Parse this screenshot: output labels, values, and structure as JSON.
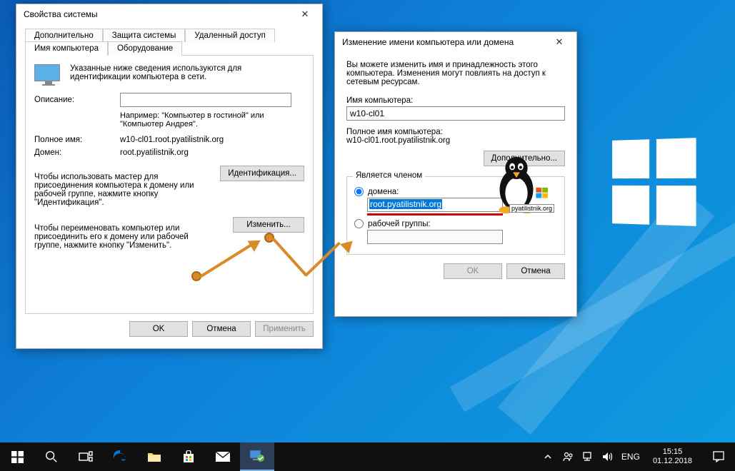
{
  "desktop": {
    "os": "Windows 10"
  },
  "dialog1": {
    "title": "Свойства системы",
    "tabs_row1": [
      "Дополнительно",
      "Защита системы",
      "Удаленный доступ"
    ],
    "tabs_row2": [
      "Имя компьютера",
      "Оборудование"
    ],
    "active_tab": "Имя компьютера",
    "intro": "Указанные ниже сведения используются для идентификации компьютера в сети.",
    "desc_label": "Описание:",
    "desc_value": "",
    "desc_hint": "Например: \"Компьютер в гостиной\" или \"Компьютер Андрея\".",
    "fullname_label": "Полное имя:",
    "fullname_value": "w10-cl01.root.pyatilistnik.org",
    "domain_label": "Домен:",
    "domain_value": "root.pyatilistnik.org",
    "wizard_text": "Чтобы использовать мастер для присоединения компьютера к домену или рабочей группе, нажмите кнопку \"Идентификация\".",
    "ident_btn": "Идентификация...",
    "rename_text": "Чтобы переименовать компьютер или присоединить его к домену или рабочей группе, нажмите кнопку \"Изменить\".",
    "change_btn": "Изменить...",
    "ok_btn": "OK",
    "cancel_btn": "Отмена",
    "apply_btn": "Применить"
  },
  "dialog2": {
    "title": "Изменение имени компьютера или домена",
    "intro": "Вы можете изменить имя и принадлежность этого компьютера. Изменения могут повлиять на доступ к сетевым ресурсам.",
    "name_label": "Имя компьютера:",
    "name_value": "w10-cl01",
    "fullname_label": "Полное имя компьютера:",
    "fullname_value": "w10-cl01.root.pyatilistnik.org",
    "more_btn": "Дополнительно...",
    "member_legend": "Является членом",
    "radio_domain": "домена:",
    "domain_value": "root.pyatilistnik.org",
    "radio_workgroup": "рабочей группы:",
    "workgroup_value": "",
    "ok_btn": "OK",
    "cancel_btn": "Отмена",
    "watermark": "pyatilistnik.org"
  },
  "taskbar": {
    "lang": "ENG",
    "time": "15:15",
    "date": "01.12.2018"
  }
}
